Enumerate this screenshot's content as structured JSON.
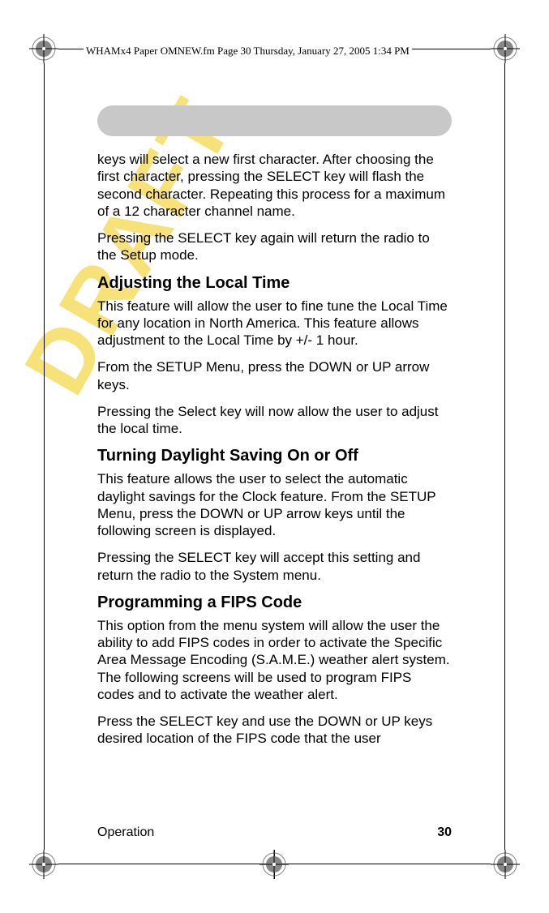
{
  "header": "WHAMx4 Paper OMNEW.fm  Page 30  Thursday, January 27, 2005   1:34 PM",
  "watermark": "DRAFT",
  "p1": "keys will select a new first character. After choosing the first character, pressing the SELECT key will flash the second character. Repeating this process for a maximum of a 12 character channel name.",
  "p2": "Pressing the SELECT key again will return the radio to the Setup mode.",
  "h1": "Adjusting the Local Time",
  "p3": "This feature will allow the user to fine tune the Local Time for any location in North America. This feature allows adjustment to the Local Time by +/- 1 hour.",
  "p4": "From the SETUP Menu, press the DOWN or UP arrow keys.",
  "p5": "Pressing the Select key will now allow the user to adjust the local time.",
  "h2": "Turning Daylight Saving On or Off",
  "p6": "This feature allows the user to select the automatic daylight savings for the Clock feature. From the SETUP Menu, press the DOWN or UP arrow keys until the following screen is displayed.",
  "p7": "Pressing the SELECT key will accept this setting and return the radio to the System menu.",
  "h3": "Programming a FIPS Code",
  "p8": "This option from the menu system will allow the user the ability to add FIPS codes in order to activate the Specific Area Message Encoding (S.A.M.E.) weather alert system. The following screens will be used to program FIPS codes and to activate the weather alert.",
  "p9": "Press the SELECT key and use the DOWN or UP keys desired location of the FIPS code that the user",
  "footer_label": "Operation",
  "page_number": "30"
}
